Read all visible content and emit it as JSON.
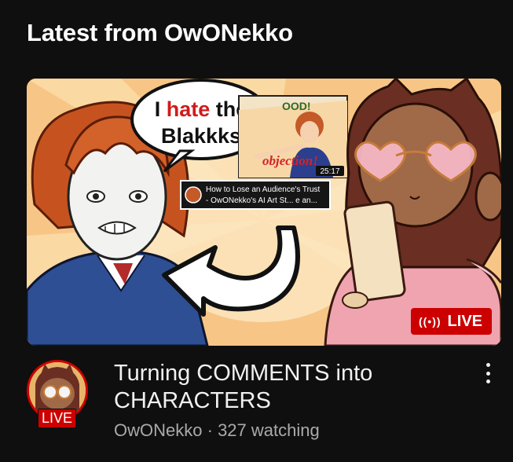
{
  "section": {
    "title": "Latest from OwONekko"
  },
  "video": {
    "title": "Turning COMMENTS into CHARACTERS",
    "channel": "OwONekko",
    "separator": "·",
    "watching": "327 watching",
    "live_label": "LIVE",
    "live_icon": "broadcast-icon"
  },
  "thumbnail": {
    "speech_hate_prefix": "I ",
    "speech_hate_word": "hate",
    "speech_hate_suffix": " the",
    "speech_line2": "Blakkks",
    "inner_duration": "25:17",
    "inner_title_line1": "How to Lose an Audience's Trust",
    "inner_title_line2": "- OwONekko's AI Art St... e an...",
    "inner_banner_top": "OOD!",
    "inner_banner": "objection!"
  },
  "avatar": {
    "live_label": "LIVE"
  },
  "colors": {
    "accent": "#cc0000",
    "background": "#0f0f0f",
    "secondary_text": "#aaaaaa"
  }
}
